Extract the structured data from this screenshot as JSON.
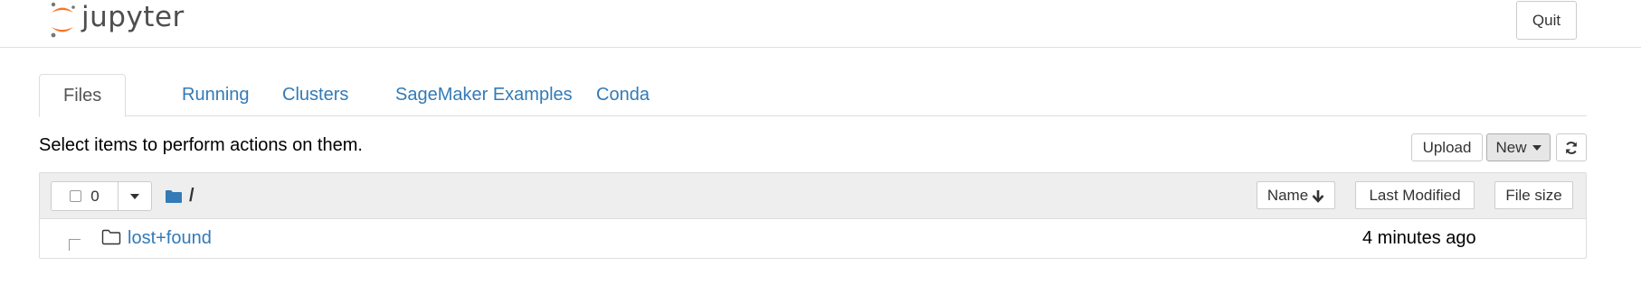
{
  "header": {
    "logo_text": "jupyter",
    "quit_label": "Quit",
    "colors": {
      "logo_orange": "#f37726",
      "logo_gray": "#767677"
    }
  },
  "tabs": [
    {
      "label": "Files",
      "active": true
    },
    {
      "label": "Running",
      "active": false
    },
    {
      "label": "Clusters",
      "active": false
    },
    {
      "label": "SageMaker Examples",
      "active": false
    },
    {
      "label": "Conda",
      "active": false
    }
  ],
  "toolbar": {
    "instructions": "Select items to perform actions on them.",
    "upload_label": "Upload",
    "new_label": "New",
    "refresh_icon": "refresh-icon"
  },
  "file_list": {
    "selected_count": "0",
    "breadcrumb_root": "/",
    "columns": {
      "name": "Name",
      "last_modified": "Last Modified",
      "file_size": "File size"
    },
    "items": [
      {
        "name": "lost+found",
        "type": "folder",
        "modified": "4 minutes ago"
      }
    ]
  },
  "colors": {
    "link": "#337ab7",
    "header_bg": "#eeeeee",
    "border": "#dddddd"
  }
}
